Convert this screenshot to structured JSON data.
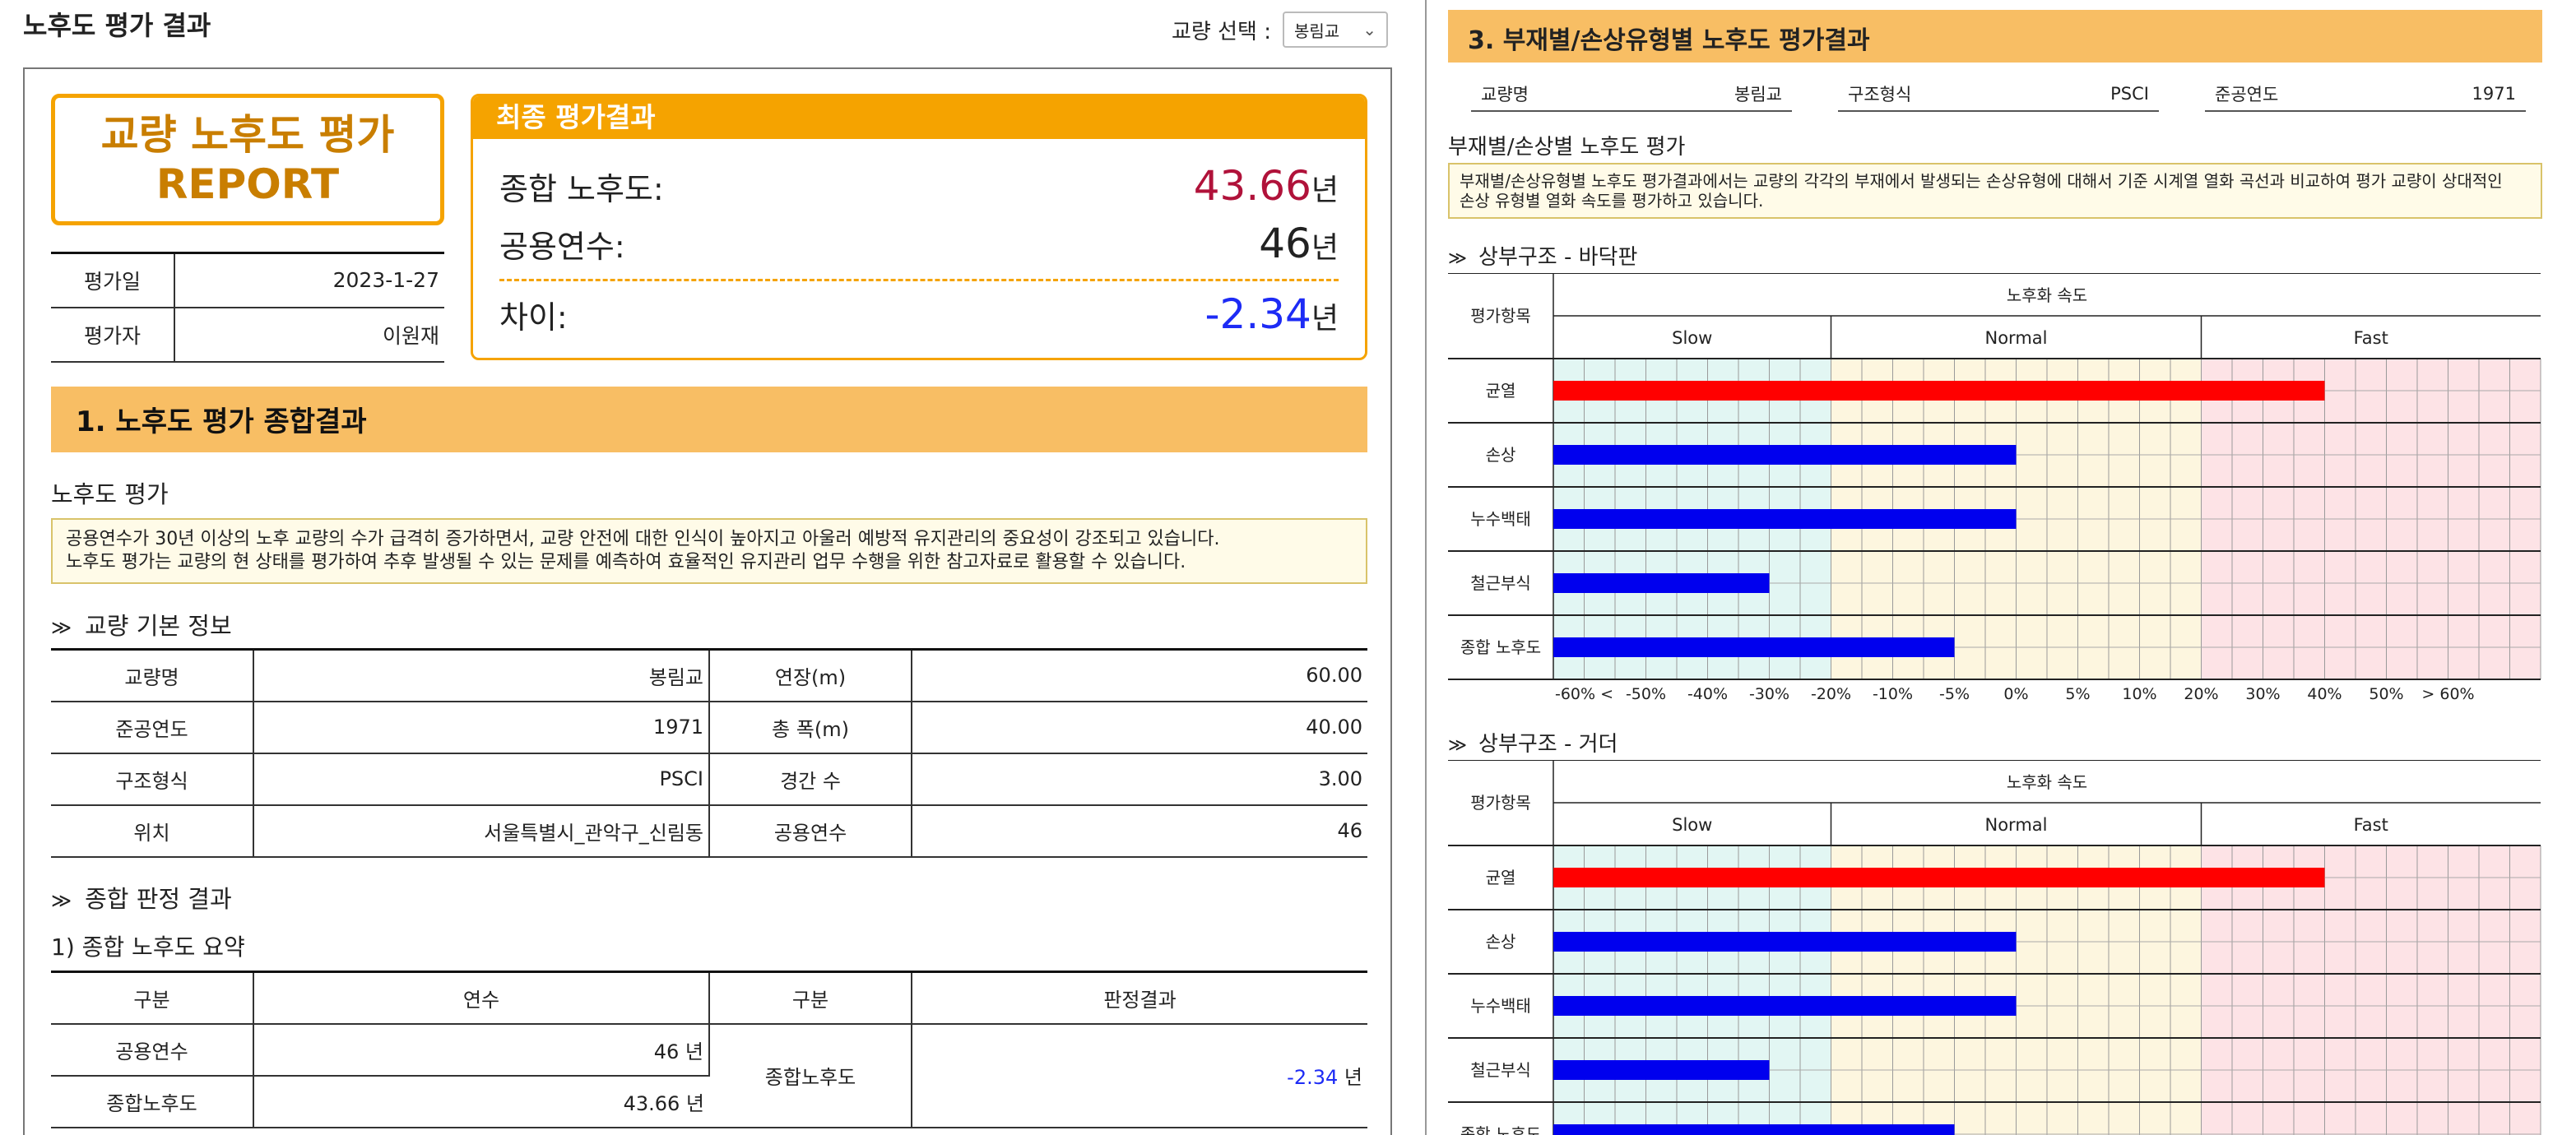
{
  "header": {
    "title": "노후도 평가 결과",
    "bridge_select_label": "교량 선택 :",
    "bridge_select_value": "봉림교"
  },
  "report": {
    "title_line1": "교량 노후도 평가",
    "title_line2": "REPORT",
    "meta": [
      {
        "label": "평가일",
        "value": "2023-1-27"
      },
      {
        "label": "평가자",
        "value": "이원재"
      }
    ]
  },
  "final_result": {
    "heading": "최종 평가결과",
    "combined_label": "종합 노후도:",
    "combined_value": "43.66",
    "service_label": "공용연수:",
    "service_value": "46",
    "diff_label": "차이:",
    "diff_value": "-2.34",
    "unit": "년",
    "colors": {
      "combined": "#b0123a",
      "service": "#222222",
      "diff": "#1d2bf5"
    }
  },
  "section1": {
    "title": "1. 노후도 평가 종합결과",
    "subheading": "노후도 평가",
    "note_line1": "공용연수가 30년 이상의 노후 교량의 수가 급격히 증가하면서, 교량 안전에 대한 인식이 높아지고 아울러 예방적 유지관리의 중요성이 강조되고 있습니다.",
    "note_line2": "노후도 평가는 교량의 현 상태를 평가하여 추후 발생될 수 있는 문제를 예측하여 효율적인 유지관리 업무 수행을 위한 참고자료로 활용할 수 있습니다.",
    "basic_info_title": "교량 기본 정보",
    "basic_info": [
      [
        "교량명",
        "봉림교",
        "연장(m)",
        "60.00"
      ],
      [
        "준공연도",
        "1971",
        "총 폭(m)",
        "40.00"
      ],
      [
        "구조형식",
        "PSCI",
        "경간 수",
        "3.00"
      ],
      [
        "위치",
        "서울특별시_관악구_신림동",
        "공용연수",
        "46"
      ]
    ],
    "judgement_title": "종합 판정 결과",
    "summary_title": "1) 종합 노후도 요약",
    "summary_headers": [
      "구분",
      "연수",
      "구분",
      "판정결과"
    ],
    "summary_rows": [
      {
        "label": "공용연수",
        "value": "46 년"
      },
      {
        "label": "종합노후도",
        "value": "43.66 년"
      }
    ],
    "summary_right_label": "종합노후도",
    "summary_right_value": "-2.34",
    "summary_right_unit": "년"
  },
  "section3": {
    "title": "3. 부재별/손상유형별 노후도 평가결과",
    "meta": [
      {
        "label": "교량명",
        "value": "봉림교"
      },
      {
        "label": "구조형식",
        "value": "PSCI"
      },
      {
        "label": "준공연도",
        "value": "1971"
      }
    ],
    "subheading": "부재별/손상별 노후도 평가",
    "note_line1": "부재별/손상유형별 노후도 평가결과에서는 교량의 각각의 부재에서 발생되는 손상유형에 대해서 기준 시계열 열화 곡선과 비교하여 평가 교량이 상대적인",
    "note_line2": "손상 유형별 열화 속도를 평가하고 있습니다."
  },
  "chart_data": [
    {
      "type": "bar",
      "title": "상부구조 - 바닥판",
      "row_header": "평가항목",
      "speed_header": "노후화 속도",
      "zones": [
        "Slow",
        "Normal",
        "Fast"
      ],
      "x_tick_labels": [
        "-60% <",
        "-50%",
        "-40%",
        "-30%",
        "-20%",
        "-10%",
        "-5%",
        "0%",
        "5%",
        "10%",
        "20%",
        "30%",
        "40%",
        "50%",
        "> 60%"
      ],
      "categories": [
        "균열",
        "손상",
        "누수백태",
        "철근부식",
        "종합 노후도"
      ],
      "values_pct": [
        40,
        0,
        0,
        -30,
        -5
      ],
      "bar_colors": [
        "#ff0000",
        "#0000ee",
        "#0000ee",
        "#0000ee",
        "#0000ee"
      ]
    },
    {
      "type": "bar",
      "title": "상부구조 - 거더",
      "row_header": "평가항목",
      "speed_header": "노후화 속도",
      "zones": [
        "Slow",
        "Normal",
        "Fast"
      ],
      "x_tick_labels": [],
      "categories": [
        "균열",
        "손상",
        "누수백태",
        "철근부식",
        "종합 노후도"
      ],
      "values_pct": [
        40,
        0,
        0,
        -30,
        -5
      ],
      "bar_colors": [
        "#ff0000",
        "#0000ee",
        "#0000ee",
        "#0000ee",
        "#0000ee"
      ]
    }
  ]
}
